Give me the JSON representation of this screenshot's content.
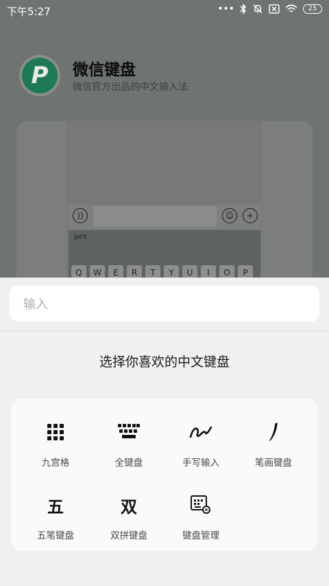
{
  "status_bar": {
    "time": "下午5:27",
    "battery": "25"
  },
  "background_app": {
    "title": "微信键盘",
    "subtitle": "微信官方出品的中文输入法",
    "preview": {
      "pinyin": "jin't",
      "keys": [
        "Q",
        "W",
        "E",
        "R",
        "T",
        "Y",
        "U",
        "I",
        "O",
        "P"
      ]
    }
  },
  "sheet": {
    "search_placeholder": "输入",
    "prompt": "选择你喜欢的中文键盘",
    "options": [
      {
        "label": "九宫格",
        "icon": "nine-grid-icon"
      },
      {
        "label": "全键盘",
        "icon": "full-keyboard-icon"
      },
      {
        "label": "手写输入",
        "icon": "handwriting-icon"
      },
      {
        "label": "笔画键盘",
        "icon": "stroke-icon"
      },
      {
        "label": "五笔键盘",
        "icon": "wubi-icon",
        "glyph": "五"
      },
      {
        "label": "双拼键盘",
        "icon": "shuangpin-icon",
        "glyph": "双"
      },
      {
        "label": "键盘管理",
        "icon": "keyboard-settings-icon"
      }
    ]
  }
}
